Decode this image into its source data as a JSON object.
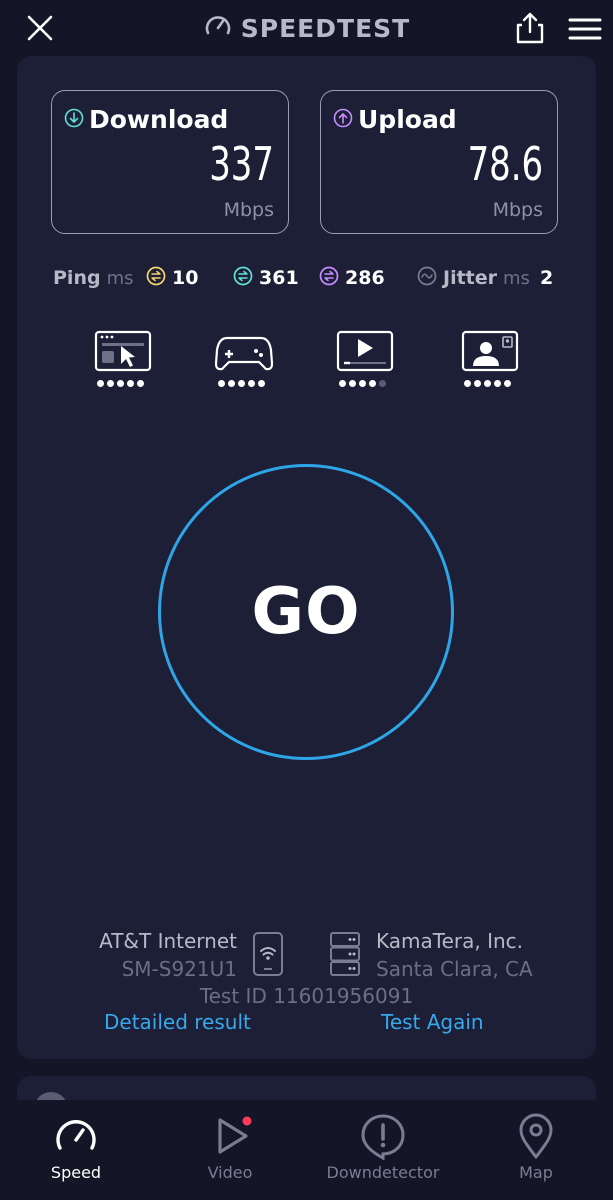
{
  "header": {
    "brand": "SPEEDTEST",
    "icons": [
      "close-icon",
      "speedometer-icon",
      "share-icon",
      "menu-icon"
    ]
  },
  "download": {
    "label": "Download",
    "value": "337",
    "unit": "Mbps"
  },
  "upload": {
    "label": "Upload",
    "value": "78.6",
    "unit": "Mbps"
  },
  "latency": {
    "ping_label": "Ping",
    "ping_unit": "ms",
    "idle": "10",
    "download": "361",
    "upload": "286",
    "jitter_label": "Jitter",
    "jitter_unit": "ms",
    "jitter": "2"
  },
  "quality_ratings": [
    {
      "icon": "browsing-icon",
      "rating": 5,
      "max": 5
    },
    {
      "icon": "gaming-icon",
      "rating": 5,
      "max": 5
    },
    {
      "icon": "video-streaming-icon",
      "rating": 4,
      "max": 5
    },
    {
      "icon": "video-call-icon",
      "rating": 5,
      "max": 5
    }
  ],
  "go_button": {
    "label": "GO"
  },
  "connection": {
    "isp": "AT&T Internet",
    "device": "SM-S921U1",
    "server": "KamaTera, Inc.",
    "location": "Santa Clara, CA",
    "test_id": "Test ID 11601956091"
  },
  "links": {
    "detailed": "Detailed result",
    "again": "Test Again"
  },
  "nav": [
    {
      "label": "Speed",
      "icon": "speedometer-icon",
      "active": true
    },
    {
      "label": "Video",
      "icon": "play-icon",
      "badge": true
    },
    {
      "label": "Downdetector",
      "icon": "alert-icon"
    },
    {
      "label": "Map",
      "icon": "map-pin-icon"
    }
  ],
  "colors": {
    "background": "#141526",
    "card": "#1c1f35",
    "accent_blue": "#2da6e8",
    "link_blue": "#38a8ec",
    "download_teal": "#5fe0d8",
    "upload_purple": "#c78cff",
    "idle_yellow": "#f5d46c",
    "badge_red": "#ff3b5c"
  }
}
